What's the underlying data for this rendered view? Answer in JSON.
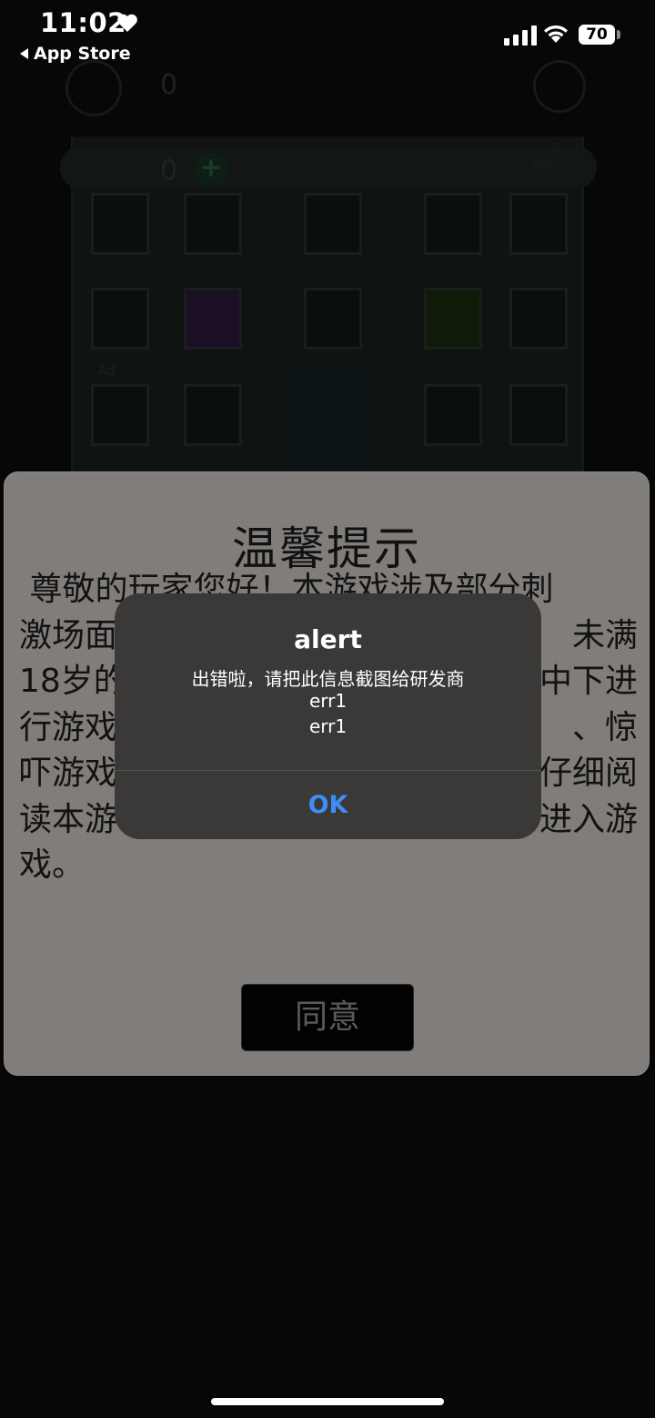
{
  "status_bar": {
    "time": "11:02",
    "back_label": "App Store",
    "battery": "70",
    "icons": [
      "heart-icon",
      "back-arrow-icon",
      "signal-icon",
      "wifi-icon",
      "battery-icon"
    ]
  },
  "game_hud": {
    "score_top": "0",
    "score_second": "0",
    "ad_label": "Ad",
    "icons": [
      "plus-icon",
      "speaker-icon"
    ]
  },
  "notice": {
    "title": "温馨提示",
    "lines": [
      " 尊敬的玩家您好！本游戏涉及部分刺",
      "激场面",
      "18岁的",
      "行游戏",
      "吓游戏",
      "读本游",
      "戏。"
    ],
    "right_fragments": [
      "未满",
      "中下进",
      "、惊",
      "仔细阅",
      "进入游"
    ],
    "agree_label": "同意"
  },
  "alert": {
    "title": "alert",
    "message_line1": "出错啦，请把此信息截图给研发商",
    "message_line2": "err1",
    "message_line3": "err1",
    "ok_label": "OK",
    "ok_color": "#3f8ef5"
  }
}
